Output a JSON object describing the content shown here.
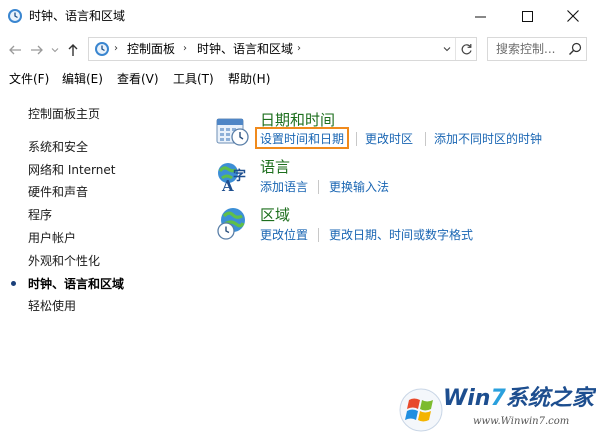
{
  "window": {
    "title": "时钟、语言和区域"
  },
  "addressbar": {
    "breadcrumbs": [
      "控制面板",
      "时钟、语言和区域"
    ],
    "search_placeholder": "搜索控制..."
  },
  "menubar": {
    "items": [
      "文件(F)",
      "编辑(E)",
      "查看(V)",
      "工具(T)",
      "帮助(H)"
    ]
  },
  "sidebar": {
    "items": [
      {
        "label": "控制面板主页"
      },
      {
        "label": "系统和安全"
      },
      {
        "label": "网络和 Internet"
      },
      {
        "label": "硬件和声音"
      },
      {
        "label": "程序"
      },
      {
        "label": "用户帐户"
      },
      {
        "label": "外观和个性化"
      },
      {
        "label": "时钟、语言和区域",
        "current": true
      },
      {
        "label": "轻松使用"
      }
    ]
  },
  "categories": [
    {
      "title": "日期和时间",
      "icon": "calendar-clock-icon",
      "links": [
        "设置时间和日期",
        "更改时区",
        "添加不同时区的时钟"
      ],
      "highlighted_link": "设置时间和日期"
    },
    {
      "title": "语言",
      "icon": "language-icon",
      "links": [
        "添加语言",
        "更换输入法"
      ]
    },
    {
      "title": "区域",
      "icon": "globe-clock-icon",
      "links": [
        "更改位置",
        "更改日期、时间或数字格式"
      ]
    }
  ],
  "watermark": {
    "brand_prefix": "Win",
    "brand_seven": "7",
    "brand_suffix": "系统之家",
    "url": "www.Winwin7.com"
  },
  "colors": {
    "category_title": "#1e6f1e",
    "link": "#1a66b3",
    "highlight_border": "#f08a1c"
  }
}
